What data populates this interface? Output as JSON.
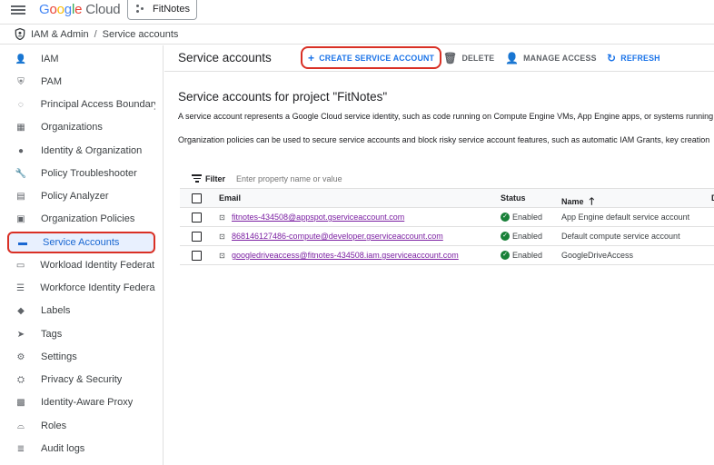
{
  "header": {
    "logo": {
      "g1": "G",
      "g2": "o",
      "g3": "o",
      "g4": "g",
      "g5": "l",
      "g6": "e",
      "cloud": " Cloud"
    },
    "project": "FitNotes"
  },
  "breadcrumb": {
    "section": "IAM & Admin",
    "separator": "/",
    "page": "Service accounts"
  },
  "sidebar": {
    "items": [
      {
        "label": "IAM",
        "icon": "person-add-icon"
      },
      {
        "label": "PAM",
        "icon": "shield-check-icon"
      },
      {
        "label": "Principal Access Boundary",
        "icon": "boundary-icon"
      },
      {
        "label": "Organizations",
        "icon": "building-icon"
      },
      {
        "label": "Identity & Organization",
        "icon": "person-icon"
      },
      {
        "label": "Policy Troubleshooter",
        "icon": "wrench-icon"
      },
      {
        "label": "Policy Analyzer",
        "icon": "document-search-icon"
      },
      {
        "label": "Organization Policies",
        "icon": "policy-icon"
      },
      {
        "label": "Service Accounts",
        "icon": "service-account-icon"
      },
      {
        "label": "Workload Identity Federat...",
        "icon": "id-card-icon"
      },
      {
        "label": "Workforce Identity Federa...",
        "icon": "list-icon"
      },
      {
        "label": "Labels",
        "icon": "label-icon"
      },
      {
        "label": "Tags",
        "icon": "tag-icon"
      },
      {
        "label": "Settings",
        "icon": "gear-icon"
      },
      {
        "label": "Privacy & Security",
        "icon": "shield-gear-icon"
      },
      {
        "label": "Identity-Aware Proxy",
        "icon": "proxy-icon"
      },
      {
        "label": "Roles",
        "icon": "hat-icon"
      },
      {
        "label": "Audit logs",
        "icon": "logs-icon"
      }
    ],
    "active_index": 8
  },
  "toolbar": {
    "title": "Service accounts",
    "create": "CREATE SERVICE ACCOUNT",
    "delete": "DELETE",
    "manage": "MANAGE ACCESS",
    "refresh": "REFRESH"
  },
  "main": {
    "section_title": "Service accounts for project \"FitNotes\"",
    "desc1": "A service account represents a Google Cloud service identity, such as code running on Compute Engine VMs, App Engine apps, or systems running",
    "desc2": "Organization policies can be used to secure service accounts and block risky service account features, such as automatic IAM Grants, key creation"
  },
  "filter": {
    "label": "Filter",
    "placeholder": "Enter property name or value"
  },
  "table": {
    "columns": {
      "email": "Email",
      "status": "Status",
      "name": "Name",
      "extra": "D"
    },
    "rows": [
      {
        "email": "fitnotes-434508@appspot.gserviceaccount.com",
        "status": "Enabled",
        "name": "App Engine default service account"
      },
      {
        "email": "868146127486-compute@developer.gserviceaccount.com",
        "status": "Enabled",
        "name": "Default compute service account"
      },
      {
        "email": "googledriveaccess@fitnotes-434508.iam.gserviceaccount.com",
        "status": "Enabled",
        "name": "GoogleDriveAccess"
      }
    ]
  },
  "colors": {
    "accent": "#1a73e8",
    "highlight_border": "#d93025",
    "active_bg": "#e8f0fe",
    "enabled": "#188038"
  }
}
